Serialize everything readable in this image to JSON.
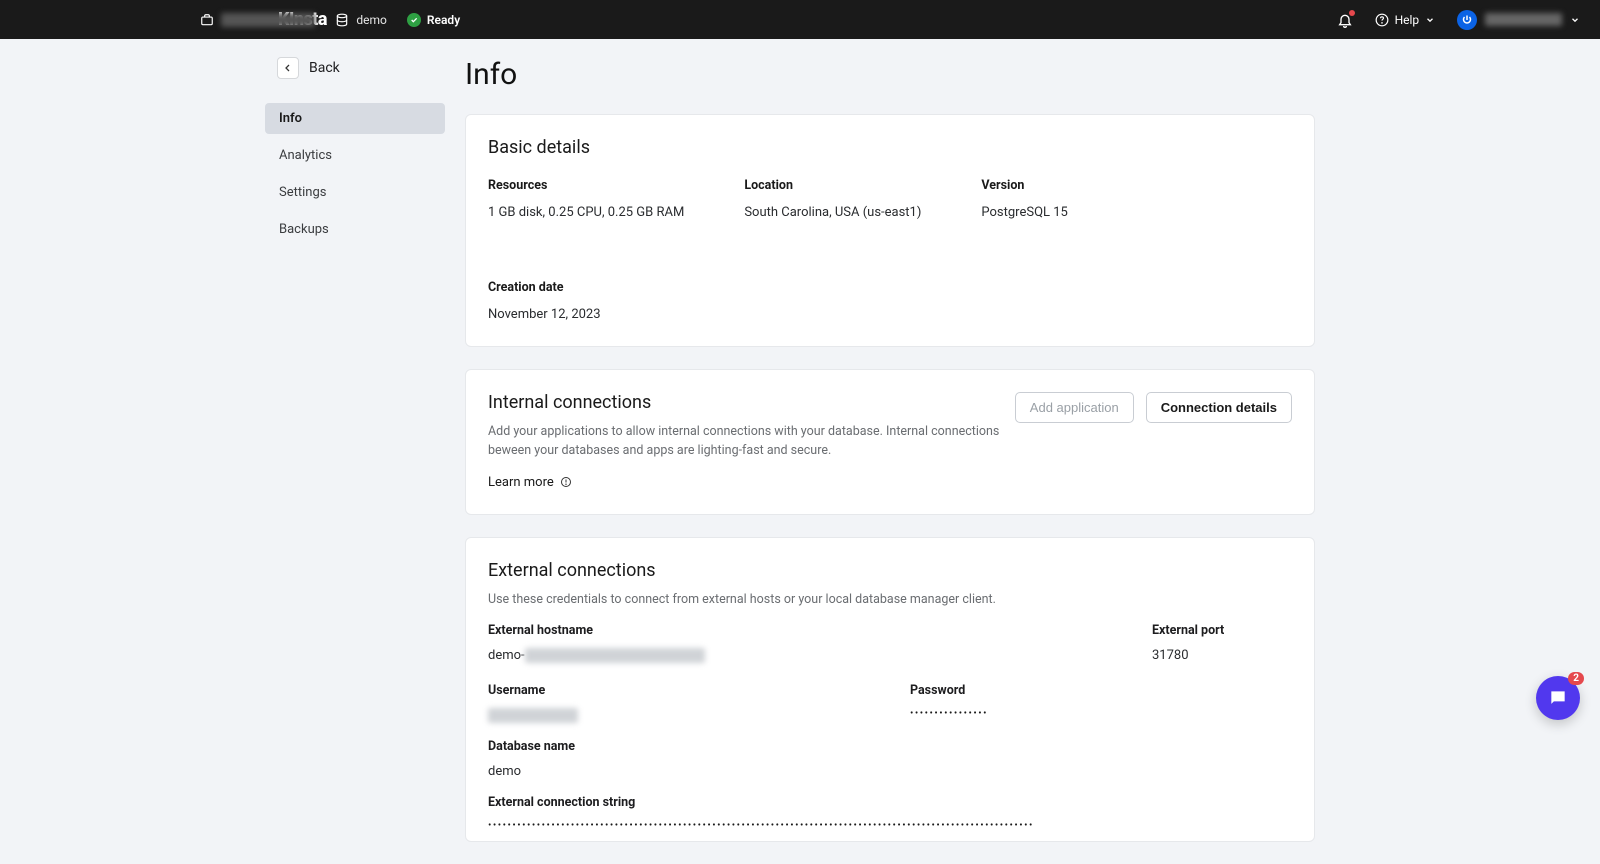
{
  "brand": "KInsta",
  "header": {
    "org_label": "organization",
    "project_label": "demo",
    "status_label": "Ready",
    "help_label": "Help",
    "user_name": "username"
  },
  "sidebar": {
    "back_label": "Back",
    "items": [
      {
        "label": "Info"
      },
      {
        "label": "Analytics"
      },
      {
        "label": "Settings"
      },
      {
        "label": "Backups"
      }
    ],
    "active_index": 0
  },
  "page": {
    "title": "Info"
  },
  "basic": {
    "title": "Basic details",
    "items": [
      {
        "label": "Resources",
        "value": "1 GB disk, 0.25 CPU, 0.25 GB RAM"
      },
      {
        "label": "Location",
        "value": "South Carolina, USA (us-east1)"
      },
      {
        "label": "Version",
        "value": "PostgreSQL 15"
      },
      {
        "label": "Creation date",
        "value": "November 12, 2023"
      }
    ]
  },
  "internal": {
    "title": "Internal connections",
    "subtext": "Add your applications to allow internal connections with your database. Internal connections beween your databases and apps are lighting-fast and secure.",
    "learn_more": "Learn more",
    "add_app_btn": "Add application",
    "details_btn": "Connection details"
  },
  "external": {
    "title": "External connections",
    "subtext": "Use these credentials to connect from external hosts or your local database manager client.",
    "hostname_label": "External hostname",
    "hostname_prefix": "demo-",
    "hostname_blur": "xxxxx.xxxxxxxxxx.xxxxxxxx.app",
    "port_label": "External port",
    "port_value": "31780",
    "username_label": "Username",
    "username_blur": "xxxxxxxxxxxxxx",
    "password_label": "Password",
    "password_dots": "••••••••••••••••",
    "dbname_label": "Database name",
    "dbname_value": "demo",
    "connstr_label": "External connection string",
    "connstr_dots": "••••••••••••••••••••••••••••••••••••••••••••••••••••••••••••••••••••••••••••••••••••••••••••••••••••••••••••••••"
  },
  "chat": {
    "badge": "2"
  }
}
